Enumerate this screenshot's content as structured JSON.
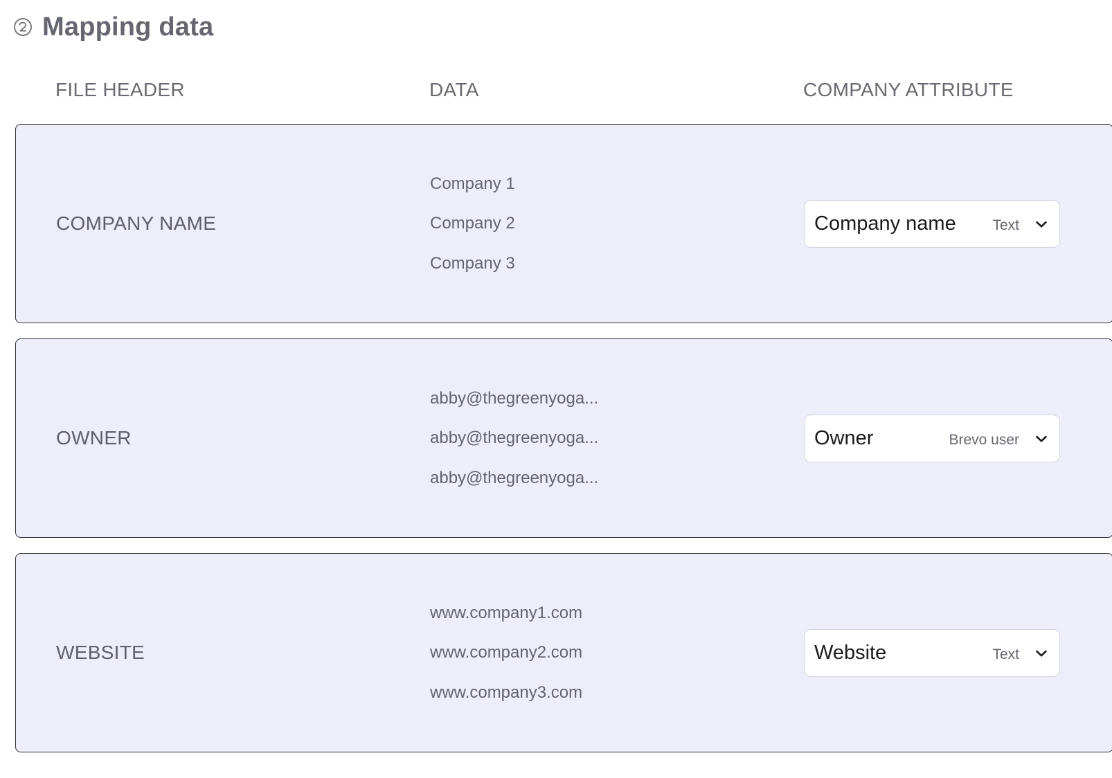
{
  "section": {
    "step_number": "②",
    "title": "Mapping data"
  },
  "columns": {
    "file_header": "FILE HEADER",
    "data": "DATA",
    "company_attribute": "COMPANY ATTRIBUTE"
  },
  "rows": [
    {
      "header": "COMPANY NAME",
      "samples": [
        "Company 1",
        "Company 2",
        "Company 3"
      ],
      "attribute": {
        "label": "Company name",
        "type": "Text"
      }
    },
    {
      "header": "OWNER",
      "samples": [
        "abby@thegreenyoga...",
        "abby@thegreenyoga...",
        "abby@thegreenyoga..."
      ],
      "attribute": {
        "label": "Owner",
        "type": "Brevo user"
      }
    },
    {
      "header": "WEBSITE",
      "samples": [
        "www.company1.com",
        "www.company2.com",
        "www.company3.com"
      ],
      "attribute": {
        "label": "Website",
        "type": "Text"
      }
    }
  ],
  "icons": {
    "step_badge": "circled-digit-two",
    "dropdown": "chevron-down-icon"
  },
  "colors": {
    "row_background": "#eeeefb",
    "row_border": "#2d2d33",
    "select_background": "#ffffff"
  }
}
